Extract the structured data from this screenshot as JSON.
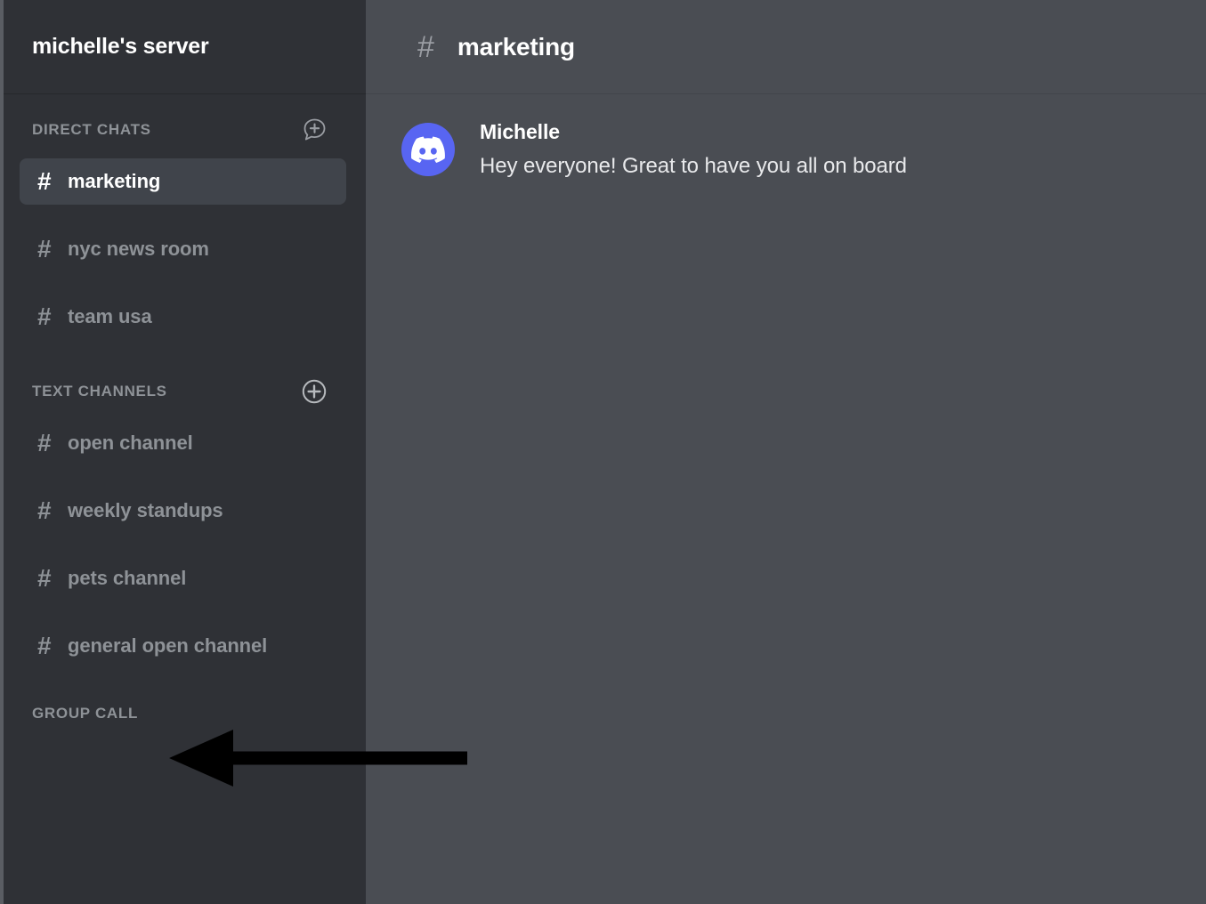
{
  "sidebar": {
    "server_title": "michelle's server",
    "sections": [
      {
        "id": "direct-chats",
        "title": "DIRECT CHATS",
        "action_icon": "chat-bubble-plus-icon",
        "channels": [
          {
            "name": "marketing",
            "hash": "#",
            "active": true
          },
          {
            "name": "nyc news room",
            "hash": "#",
            "active": false
          },
          {
            "name": "team usa",
            "hash": "#",
            "active": false
          }
        ]
      },
      {
        "id": "text-channels",
        "title": "TEXT CHANNELS",
        "action_icon": "circle-plus-icon",
        "channels": [
          {
            "name": "open channel",
            "hash": "#",
            "active": false
          },
          {
            "name": "weekly standups",
            "hash": "#",
            "active": false
          },
          {
            "name": "pets channel",
            "hash": "#",
            "active": false
          },
          {
            "name": "general open channel",
            "hash": "#",
            "active": false
          }
        ]
      },
      {
        "id": "group-call",
        "title": "GROUP CALL",
        "action_icon": null,
        "channels": []
      }
    ]
  },
  "main": {
    "header": {
      "hash": "#",
      "channel_title": "marketing"
    },
    "messages": [
      {
        "author": "Michelle",
        "text": "Hey everyone! Great to have you all on board",
        "avatar_icon": "discord-logo-icon"
      }
    ]
  },
  "annotation": {
    "type": "arrow",
    "direction": "left",
    "target": "GROUP CALL",
    "color": "#000000"
  },
  "colors": {
    "sidebar_bg": "#2F3136",
    "main_bg": "#4A4D53",
    "active_item_bg": "#40444B",
    "muted_text": "#8E9297",
    "white_text": "#FFFFFF",
    "avatar_blurple": "#5865F2"
  }
}
